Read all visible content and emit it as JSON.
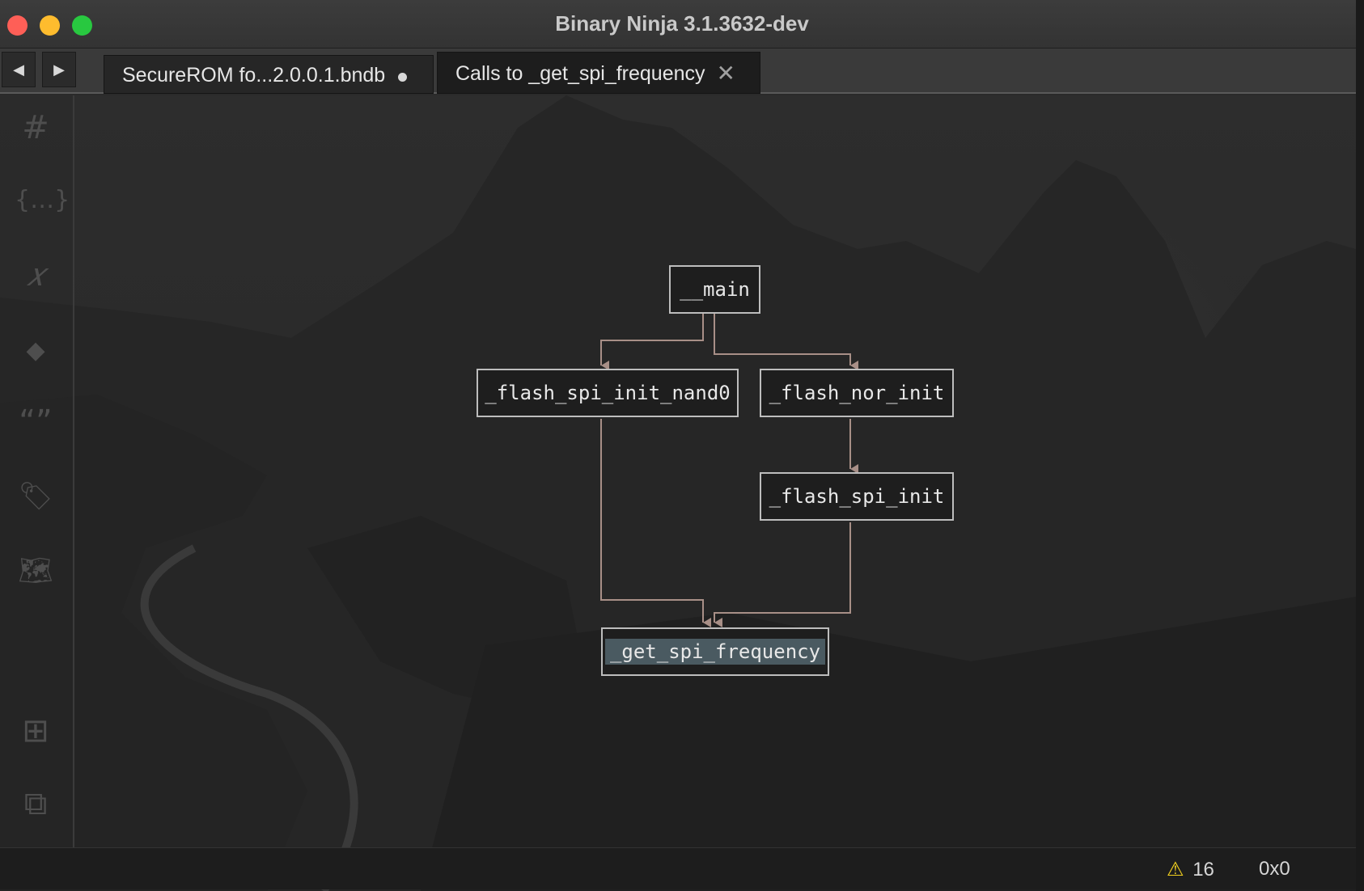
{
  "window": {
    "title": "Binary Ninja 3.1.3632-dev",
    "buttons": [
      "close",
      "minimize",
      "maximize"
    ]
  },
  "navigation": {
    "back_glyph": "◀",
    "forward_glyph": "▶"
  },
  "tabs": [
    {
      "label": "SecureROM fo...2.0.0.1.bndb",
      "modified": true
    },
    {
      "label": "Calls to _get_spi_frequency",
      "active": true,
      "close_glyph": "✕"
    }
  ],
  "sidebar": {
    "icons": [
      {
        "name": "symbols-icon",
        "glyph": "#"
      },
      {
        "name": "types-icon",
        "glyph": "{…}"
      },
      {
        "name": "variables-icon",
        "glyph": "𝑥"
      },
      {
        "name": "stack-icon",
        "glyph": "◆"
      },
      {
        "name": "strings-icon",
        "glyph": "“”"
      },
      {
        "name": "tags-icon",
        "glyph": "🏷"
      },
      {
        "name": "memory-map-icon",
        "glyph": "🗺"
      },
      {
        "name": "graph-icon",
        "glyph": "⊞"
      },
      {
        "name": "cross-references-icon",
        "glyph": "⧉"
      }
    ]
  },
  "graph": {
    "nodes": {
      "main": "__main",
      "nand": "_flash_spi_init_nand0",
      "nor": "_flash_nor_init",
      "spi": "_flash_spi_init",
      "freq": "_get_spi_frequency"
    },
    "selected": "_get_spi_frequency"
  },
  "status": {
    "warnings_count": "16",
    "warning_glyph": "⚠",
    "address": "0x0"
  },
  "colors": {
    "node_border": "#bdbdbd",
    "edge": "#a88f87",
    "selection": "#4a5a61",
    "warning": "#f4d21f"
  }
}
